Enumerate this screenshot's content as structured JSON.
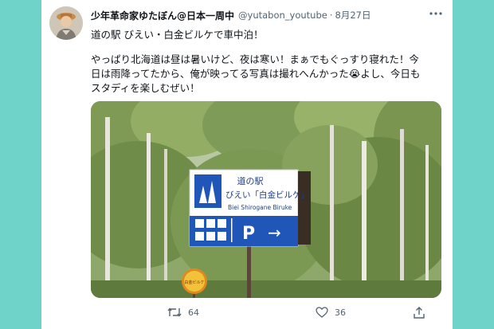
{
  "tweet": {
    "display_name": "少年革命家ゆたぼん@日本一周中",
    "handle": "@yutabon_youtube",
    "separator": "·",
    "date": "8月27日",
    "line1": "道の駅 びえい・白金ビルケで車中泊！",
    "body_lines": [
      "やっぱり北海道は昼は暑いけど、夜は寒い！まぁでもぐっすり寝れた！今",
      "日は雨降ってたから、俺が映ってる写真は撮れへんかった😭よし、今日も",
      "スタディを楽しむぜい！"
    ]
  },
  "sign": {
    "title": "道の駅",
    "name": "びえい「白金ビルケ」",
    "romaji": "Biei Shirogane Biruke",
    "parking_letter": "P",
    "arrow": "→",
    "small_sign_text": "白金ビルケ"
  },
  "actions": {
    "retweets": "64",
    "likes": "36"
  },
  "icons": [
    "more-icon",
    "retweet-icon",
    "like-icon",
    "share-icon"
  ],
  "colors": {
    "page_bg": "#6fd3c9",
    "sign_blue": "#1f56b8",
    "muted_text": "#536471"
  }
}
